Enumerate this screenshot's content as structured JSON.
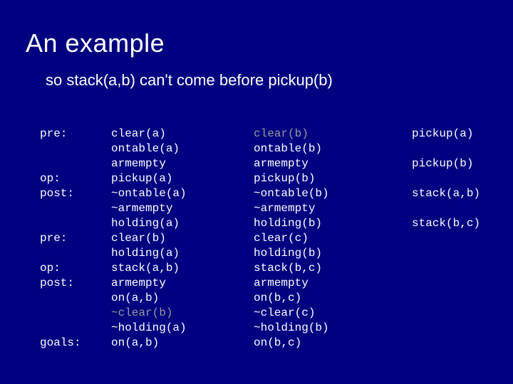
{
  "title": "An example",
  "subtitle": "so stack(a,b) can't come before pickup(b)",
  "col1": {
    "l0": "pre:",
    "l1": "",
    "l2": "",
    "l3": "op:",
    "l4": "post:",
    "l5": "",
    "l6": "",
    "l7": "pre:",
    "l8": "",
    "l9": "op:",
    "l10": "post:",
    "l11": "",
    "l12": "",
    "l13": "",
    "l14": "goals:"
  },
  "col2": {
    "l0": "clear(a)",
    "l1": "ontable(a)",
    "l2": "armempty",
    "l3": "pickup(a)",
    "l4": "~ontable(a)",
    "l5": "~armempty",
    "l6": "holding(a)",
    "l7": "clear(b)",
    "l8": "holding(a)",
    "l9": "stack(a,b)",
    "l10": "armempty",
    "l11": "on(a,b)",
    "l12": "~clear(b)",
    "l13": "~holding(a)",
    "l14": "on(a,b)"
  },
  "col3": {
    "l0": "clear(b)",
    "l1": "ontable(b)",
    "l2": "armempty",
    "l3": "pickup(b)",
    "l4": "~ontable(b)",
    "l5": "~armempty",
    "l6": "holding(b)",
    "l7": "clear(c)",
    "l8": "holding(b)",
    "l9": "stack(b,c)",
    "l10": "armempty",
    "l11": "on(b,c)",
    "l12": "~clear(c)",
    "l13": "~holding(b)",
    "l14": "on(b,c)"
  },
  "col4": {
    "l0": "pickup(a)",
    "l1": "",
    "l2": "pickup(b)",
    "l3": "",
    "l4": "stack(a,b)",
    "l5": "",
    "l6": "stack(b,c)"
  }
}
